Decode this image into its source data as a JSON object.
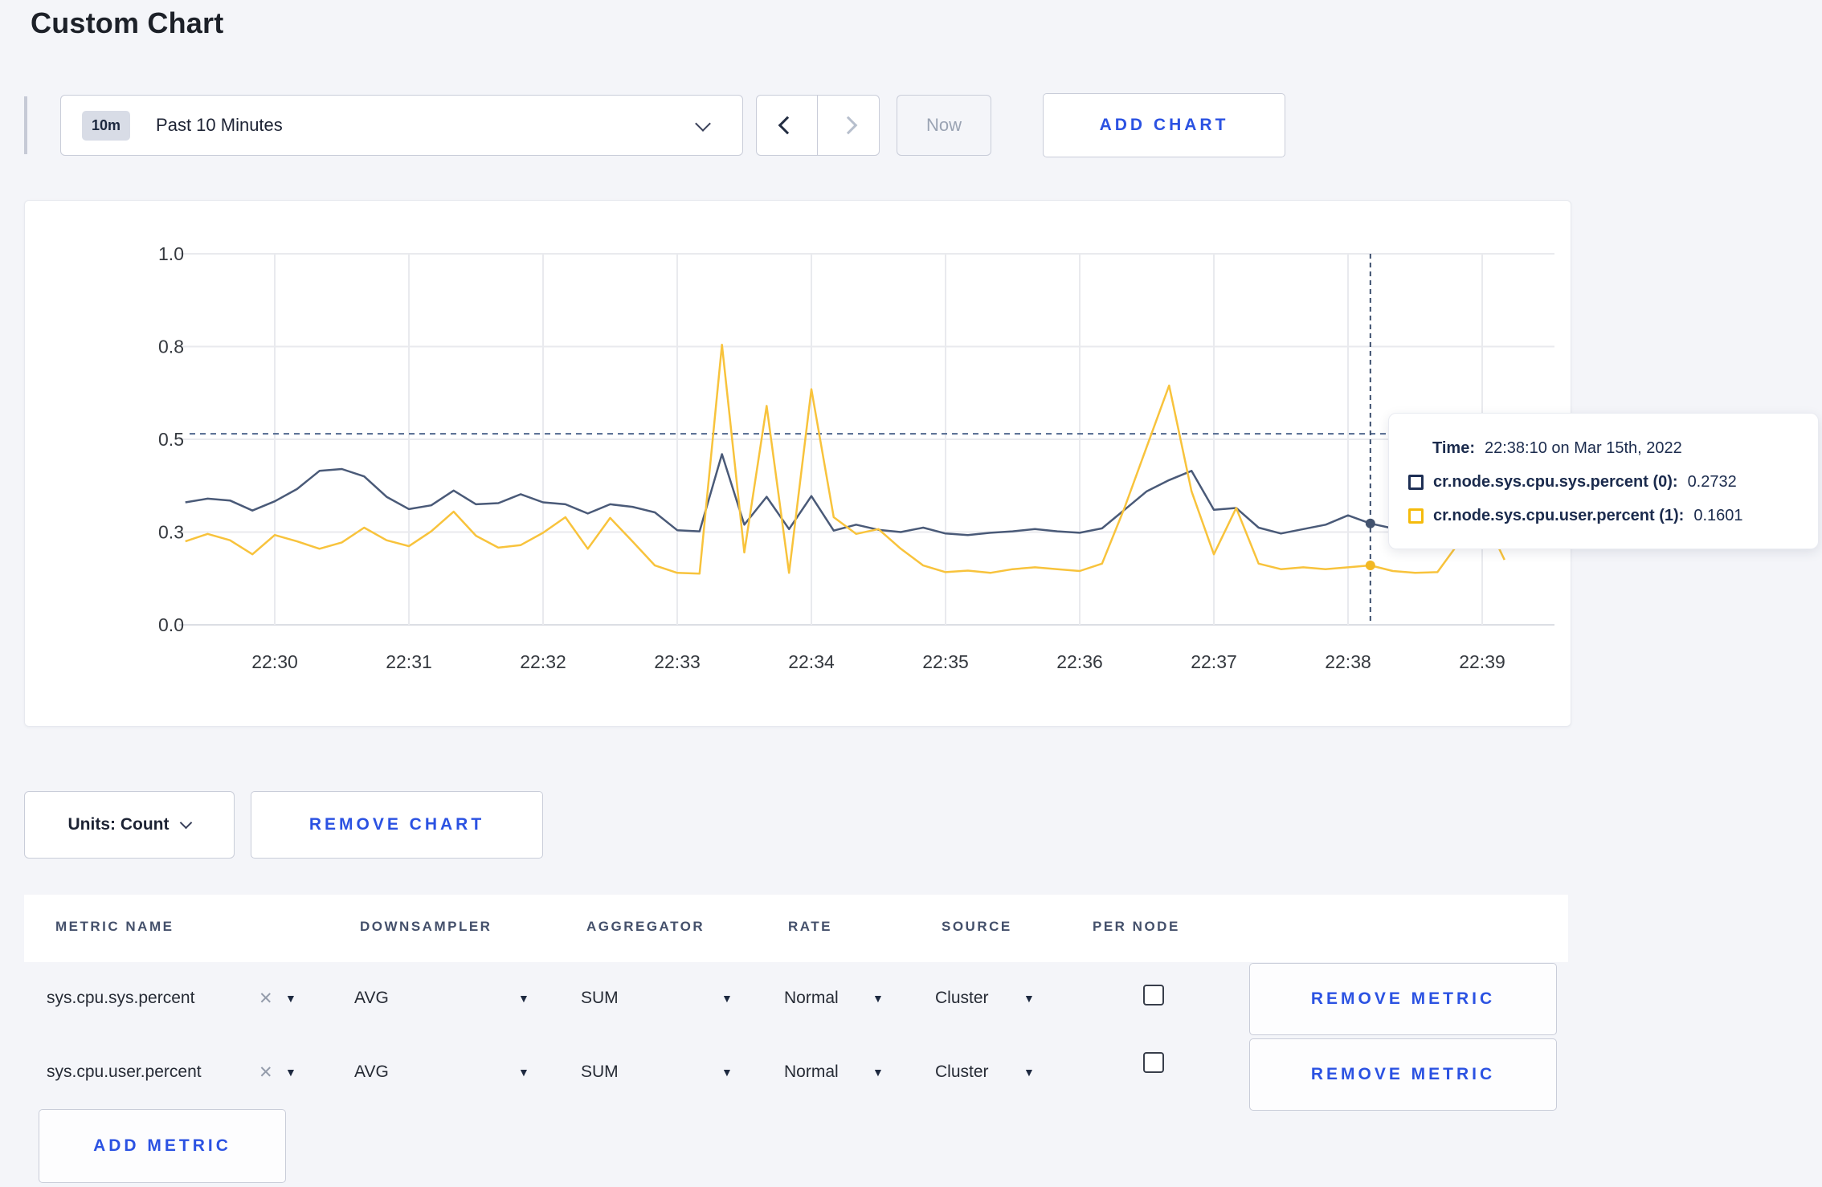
{
  "page": {
    "title": "Custom Chart",
    "background": "#f4f5f9",
    "accent_blue": "#2b52e2"
  },
  "toolbar": {
    "range_badge": "10m",
    "range_label": "Past 10 Minutes",
    "now_label": "Now",
    "add_chart_label": "ADD CHART"
  },
  "tooltip": {
    "time_label": "Time:",
    "time_value": "22:38:10 on Mar 15th, 2022",
    "series": [
      {
        "label": "cr.node.sys.cpu.sys.percent (0):",
        "value": "0.2732",
        "color": "#1e2f55"
      },
      {
        "label": "cr.node.sys.cpu.user.percent (1):",
        "value": "0.1601",
        "color": "#f5bb0c"
      }
    ]
  },
  "chart_controls": {
    "units_label": "Units: Count",
    "remove_chart_label": "REMOVE CHART",
    "add_metric_label": "ADD METRIC"
  },
  "metrics_table": {
    "headers": [
      "METRIC NAME",
      "DOWNSAMPLER",
      "AGGREGATOR",
      "RATE",
      "SOURCE",
      "PER NODE"
    ],
    "rows": [
      {
        "metric": "sys.cpu.sys.percent",
        "downsampler": "AVG",
        "aggregator": "SUM",
        "rate": "Normal",
        "source": "Cluster",
        "per_node": false,
        "remove_label": "REMOVE METRIC"
      },
      {
        "metric": "sys.cpu.user.percent",
        "downsampler": "AVG",
        "aggregator": "SUM",
        "rate": "Normal",
        "source": "Cluster",
        "per_node": false,
        "remove_label": "REMOVE METRIC"
      }
    ]
  },
  "chart_data": {
    "type": "line",
    "title": "",
    "xlabel": "",
    "ylabel": "",
    "ylim": [
      0,
      1
    ],
    "grid": true,
    "legend_position": "tooltip",
    "x_ticks": [
      "22:30",
      "22:31",
      "22:32",
      "22:33",
      "22:34",
      "22:35",
      "22:36",
      "22:37",
      "22:38",
      "22:39"
    ],
    "y_ticks": {
      "values": [
        0,
        0.25,
        0.5,
        0.75,
        1.0
      ],
      "labels": [
        "0.0",
        "0.3",
        "0.5",
        "0.8",
        "1.0"
      ]
    },
    "x": [
      "22:29:20",
      "22:29:30",
      "22:29:40",
      "22:29:50",
      "22:30:00",
      "22:30:10",
      "22:30:20",
      "22:30:30",
      "22:30:40",
      "22:30:50",
      "22:31:00",
      "22:31:10",
      "22:31:20",
      "22:31:30",
      "22:31:40",
      "22:31:50",
      "22:32:00",
      "22:32:10",
      "22:32:20",
      "22:32:30",
      "22:32:40",
      "22:32:50",
      "22:33:00",
      "22:33:10",
      "22:33:20",
      "22:33:30",
      "22:33:40",
      "22:33:50",
      "22:34:00",
      "22:34:10",
      "22:34:20",
      "22:34:30",
      "22:34:40",
      "22:34:50",
      "22:35:00",
      "22:35:10",
      "22:35:20",
      "22:35:30",
      "22:35:40",
      "22:35:50",
      "22:36:00",
      "22:36:10",
      "22:36:20",
      "22:36:30",
      "22:36:40",
      "22:36:50",
      "22:37:00",
      "22:37:10",
      "22:37:20",
      "22:37:30",
      "22:37:40",
      "22:37:50",
      "22:38:00",
      "22:38:10",
      "22:38:20",
      "22:38:30",
      "22:38:40",
      "22:38:50",
      "22:39:00",
      "22:39:10"
    ],
    "series": [
      {
        "name": "cr.node.sys.cpu.sys.percent (0)",
        "color": "#4a5a78",
        "values": [
          0.33,
          0.34,
          0.335,
          0.308,
          0.333,
          0.366,
          0.415,
          0.42,
          0.4,
          0.345,
          0.312,
          0.322,
          0.362,
          0.325,
          0.328,
          0.352,
          0.33,
          0.325,
          0.3,
          0.325,
          0.318,
          0.303,
          0.255,
          0.252,
          0.46,
          0.27,
          0.345,
          0.258,
          0.347,
          0.254,
          0.27,
          0.256,
          0.25,
          0.262,
          0.246,
          0.242,
          0.248,
          0.252,
          0.258,
          0.252,
          0.248,
          0.26,
          0.31,
          0.36,
          0.39,
          0.415,
          0.31,
          0.315,
          0.262,
          0.246,
          0.258,
          0.27,
          0.295,
          0.2732,
          0.26,
          0.285,
          0.262,
          0.256,
          0.26,
          0.25
        ]
      },
      {
        "name": "cr.node.sys.cpu.user.percent (1)",
        "color": "#f8c33c",
        "values": [
          0.225,
          0.245,
          0.228,
          0.19,
          0.242,
          0.225,
          0.205,
          0.222,
          0.262,
          0.228,
          0.212,
          0.252,
          0.305,
          0.24,
          0.208,
          0.215,
          0.248,
          0.29,
          0.205,
          0.288,
          0.225,
          0.16,
          0.14,
          0.138,
          0.755,
          0.195,
          0.59,
          0.14,
          0.635,
          0.29,
          0.245,
          0.258,
          0.205,
          0.16,
          0.142,
          0.146,
          0.14,
          0.15,
          0.155,
          0.15,
          0.145,
          0.165,
          0.315,
          0.48,
          0.645,
          0.36,
          0.19,
          0.315,
          0.165,
          0.15,
          0.155,
          0.15,
          0.155,
          0.1601,
          0.145,
          0.14,
          0.142,
          0.225,
          0.3,
          0.175
        ]
      }
    ],
    "hover": {
      "x": "22:38:10",
      "index": 53,
      "guide_y": 0.515,
      "values": [
        0.2732,
        0.1601
      ]
    }
  }
}
